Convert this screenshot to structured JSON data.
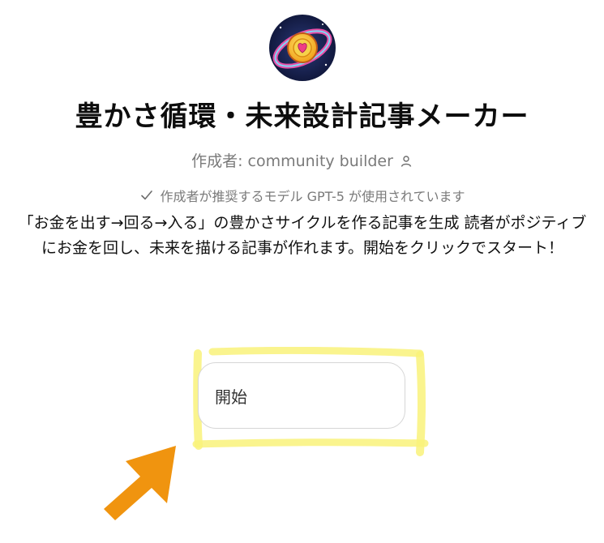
{
  "gpt": {
    "avatar_icon": "planet-heart-icon",
    "title": "豊かさ循環・未来設計記事メーカー",
    "author_line": "作成者: community builder",
    "model_note": "作成者が推奨するモデル GPT-5 が使用されています",
    "description": "「お金を出す→回る→入る」の豊かさサイクルを作る記事を生成 読者がポジティブにお金を回し、未来を描ける記事が作れます。開始をクリックでスタート！"
  },
  "conversation_starter": {
    "label": "開始"
  },
  "annotations": {
    "highlight_color": "#f9f27a",
    "arrow_color": "#f0940f",
    "arrow_icon": "arrow-up-right-icon"
  }
}
